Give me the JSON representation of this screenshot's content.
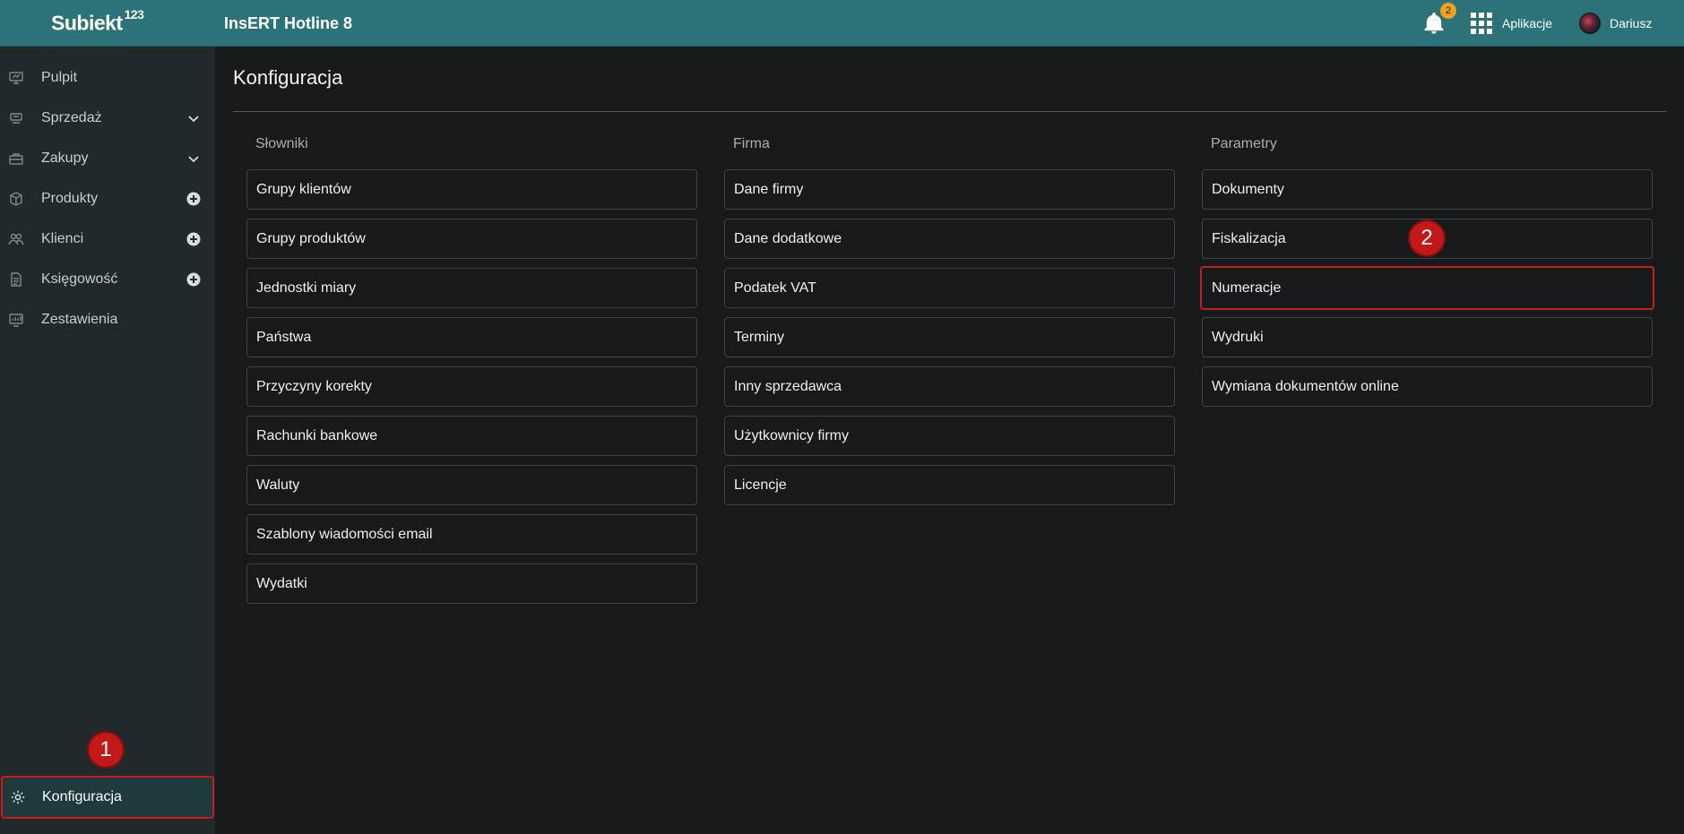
{
  "header": {
    "logo_text": "Subiekt",
    "logo_superscript": "123",
    "app_title": "InsERT Hotline 8",
    "notifications_count": "2",
    "apps_label": "Aplikacje",
    "user_label": "Dariusz"
  },
  "sidebar": {
    "items": [
      {
        "label": "Pulpit",
        "icon": "desktop-icon"
      },
      {
        "label": "Sprzedaż",
        "icon": "sales-icon",
        "right": "chevron-down-icon"
      },
      {
        "label": "Zakupy",
        "icon": "purchases-icon",
        "right": "chevron-down-icon"
      },
      {
        "label": "Produkty",
        "icon": "box-icon",
        "right": "plus-circle-icon"
      },
      {
        "label": "Klienci",
        "icon": "clients-icon",
        "right": "plus-circle-icon"
      },
      {
        "label": "Księgowość",
        "icon": "document-icon",
        "right": "plus-circle-icon"
      },
      {
        "label": "Zestawienia",
        "icon": "report-icon"
      }
    ],
    "bottom_item": {
      "label": "Konfiguracja",
      "icon": "gear-icon"
    }
  },
  "markers": {
    "one": "1",
    "two": "2"
  },
  "main": {
    "title": "Konfiguracja",
    "columns": [
      {
        "header": "Słowniki",
        "items": [
          "Grupy klientów",
          "Grupy produktów",
          "Jednostki miary",
          "Państwa",
          "Przyczyny korekty",
          "Rachunki bankowe",
          "Waluty",
          "Szablony wiadomości email",
          "Wydatki"
        ]
      },
      {
        "header": "Firma",
        "items": [
          "Dane firmy",
          "Dane dodatkowe",
          "Podatek VAT",
          "Terminy",
          "Inny sprzedawca",
          "Użytkownicy firmy",
          "Licencje"
        ]
      },
      {
        "header": "Parametry",
        "items": [
          "Dokumenty",
          "Fiskalizacja",
          "Numeracje",
          "Wydruki",
          "Wymiana dokumentów online"
        ]
      }
    ]
  },
  "colors": {
    "topbar": "#2c7379",
    "highlight": "#cc1b1b",
    "badge": "#f0a21c"
  }
}
